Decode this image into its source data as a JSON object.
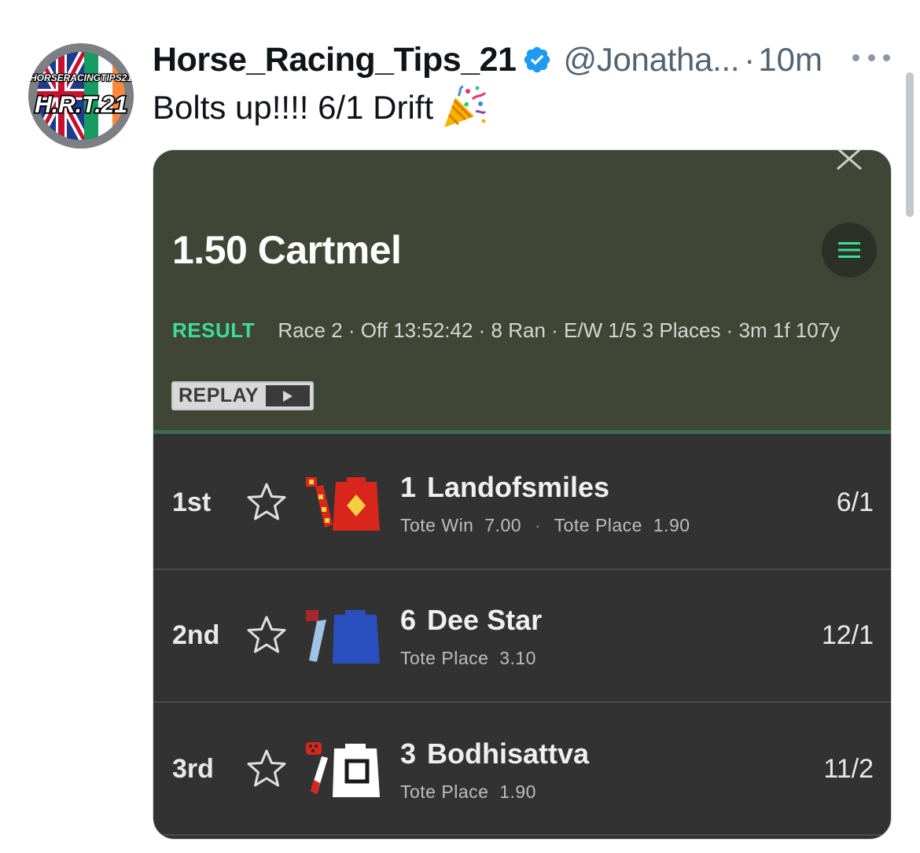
{
  "tweet": {
    "display_name": "Horse_Racing_Tips_21",
    "handle": "@Jonatha...",
    "separator": "·",
    "time": "10m",
    "text": "Bolts up!!!! 6/1 Drift",
    "text_emoji": "party-popper-icon",
    "avatar": {
      "top_text": "HORSERACINGTIPS21",
      "main_text": "H.R.T.21"
    },
    "verified_icon": "verified-badge-icon",
    "more_icon": "more-options-icon"
  },
  "race_card": {
    "title": "1.50 Cartmel",
    "result_label": "RESULT",
    "meta": "Race 2 · Off 13:52:42 · 8 Ran · E/W 1/5 3 Places · 3m 1f 107y",
    "replay_label": "REPLAY",
    "colors": {
      "header_bg": "#3f4636",
      "body_bg": "#323232",
      "accent_green": "#3ddc97"
    },
    "runners": [
      {
        "position": "1st",
        "number": "1",
        "name": "Landofsmiles",
        "tote": [
          {
            "label": "Tote Win",
            "value": "7.00"
          },
          {
            "label": "Tote Place",
            "value": "1.90"
          }
        ],
        "odds": "6/1"
      },
      {
        "position": "2nd",
        "number": "6",
        "name": "Dee Star",
        "tote": [
          {
            "label": "Tote Place",
            "value": "3.10"
          }
        ],
        "odds": "12/1"
      },
      {
        "position": "3rd",
        "number": "3",
        "name": "Bodhisattva",
        "tote": [
          {
            "label": "Tote Place",
            "value": "1.90"
          }
        ],
        "odds": "11/2"
      }
    ]
  }
}
